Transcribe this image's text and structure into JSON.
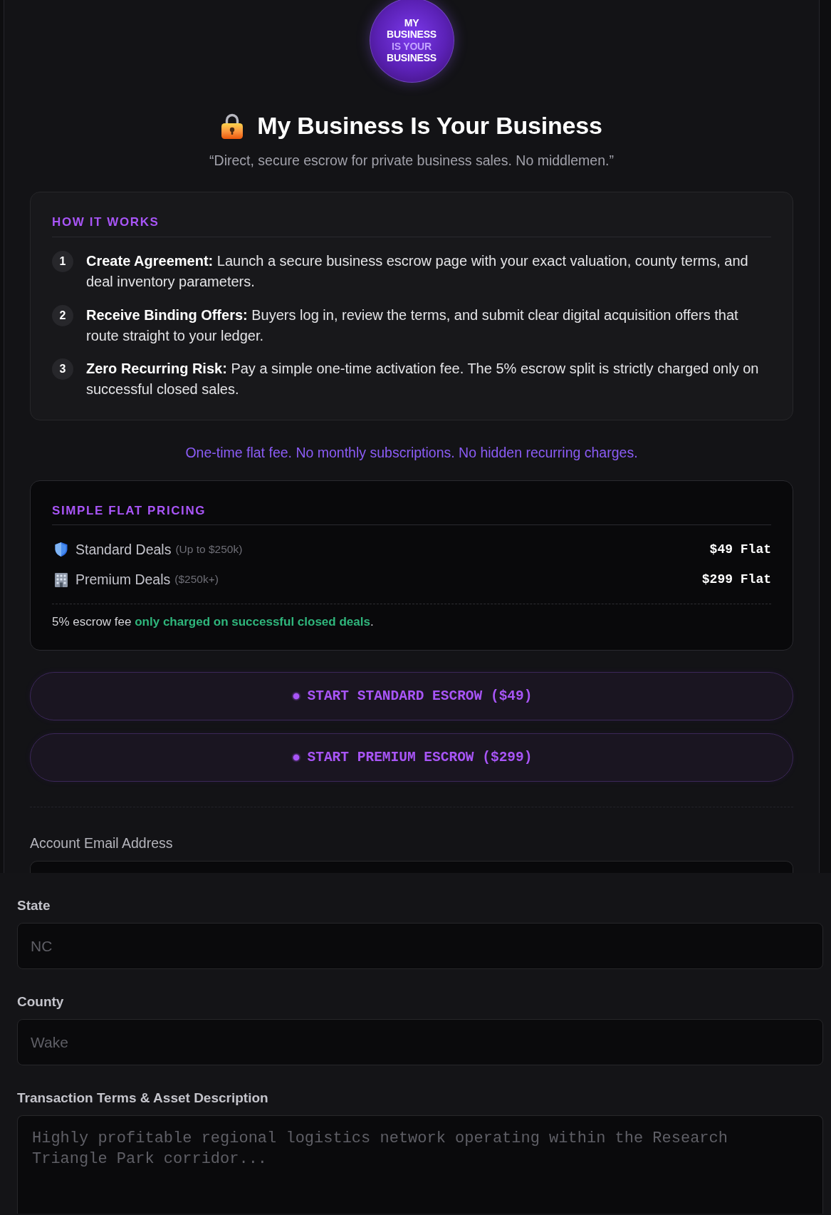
{
  "logo": {
    "lines": [
      {
        "text": "MY",
        "accent": false
      },
      {
        "text": "BUSINESS",
        "accent": false
      },
      {
        "text": "IS YOUR",
        "accent": true
      },
      {
        "text": "BUSINESS",
        "accent": false
      }
    ]
  },
  "header": {
    "title": "My Business Is Your Business",
    "tagline": "“Direct, secure escrow for private business sales. No middlemen.”"
  },
  "how_it_works": {
    "heading": "HOW IT WORKS",
    "steps": [
      {
        "number": "1",
        "text": "**Create Agreement:** Launch a secure business escrow page with your exact valuation, county terms, and deal inventory parameters."
      },
      {
        "number": "2",
        "text": "**Receive Binding Offers:** Buyers log in, review the terms, and submit clear digital acquisition offers that route straight to your ledger."
      },
      {
        "number": "3",
        "text": "**Zero Recurring Risk:** Pay a simple one-time activation fee. The 5% escrow split is strictly charged only on successful closed sales."
      }
    ]
  },
  "fee_notice": "One-time flat fee. No monthly subscriptions. No hidden recurring charges.",
  "pricing": {
    "heading": "SIMPLE FLAT PRICING",
    "plans": [
      {
        "kind": "standard",
        "name": "Standard Deals",
        "range": "(Up to $250k)",
        "price": "$49 Flat"
      },
      {
        "kind": "premium",
        "name": "Premium Deals",
        "range": "($250k+)",
        "price": "$299 Flat"
      }
    ],
    "footnote": "5% escrow fee **only charged on successful closed deals**."
  },
  "actions": [
    {
      "label": "START STANDARD ESCROW ($49)"
    },
    {
      "label": "START PREMIUM ESCROW ($299)"
    }
  ],
  "account": {
    "label": "Account Email Address"
  },
  "details": {
    "fields": [
      {
        "kind": "input",
        "label": "State",
        "placeholder": "NC"
      },
      {
        "kind": "input",
        "label": "County",
        "placeholder": "Wake"
      },
      {
        "kind": "textarea",
        "label": "Transaction Terms & Asset Description",
        "placeholder": "Highly profitable regional logistics network operating within the Research Triangle Park corridor..."
      }
    ]
  }
}
